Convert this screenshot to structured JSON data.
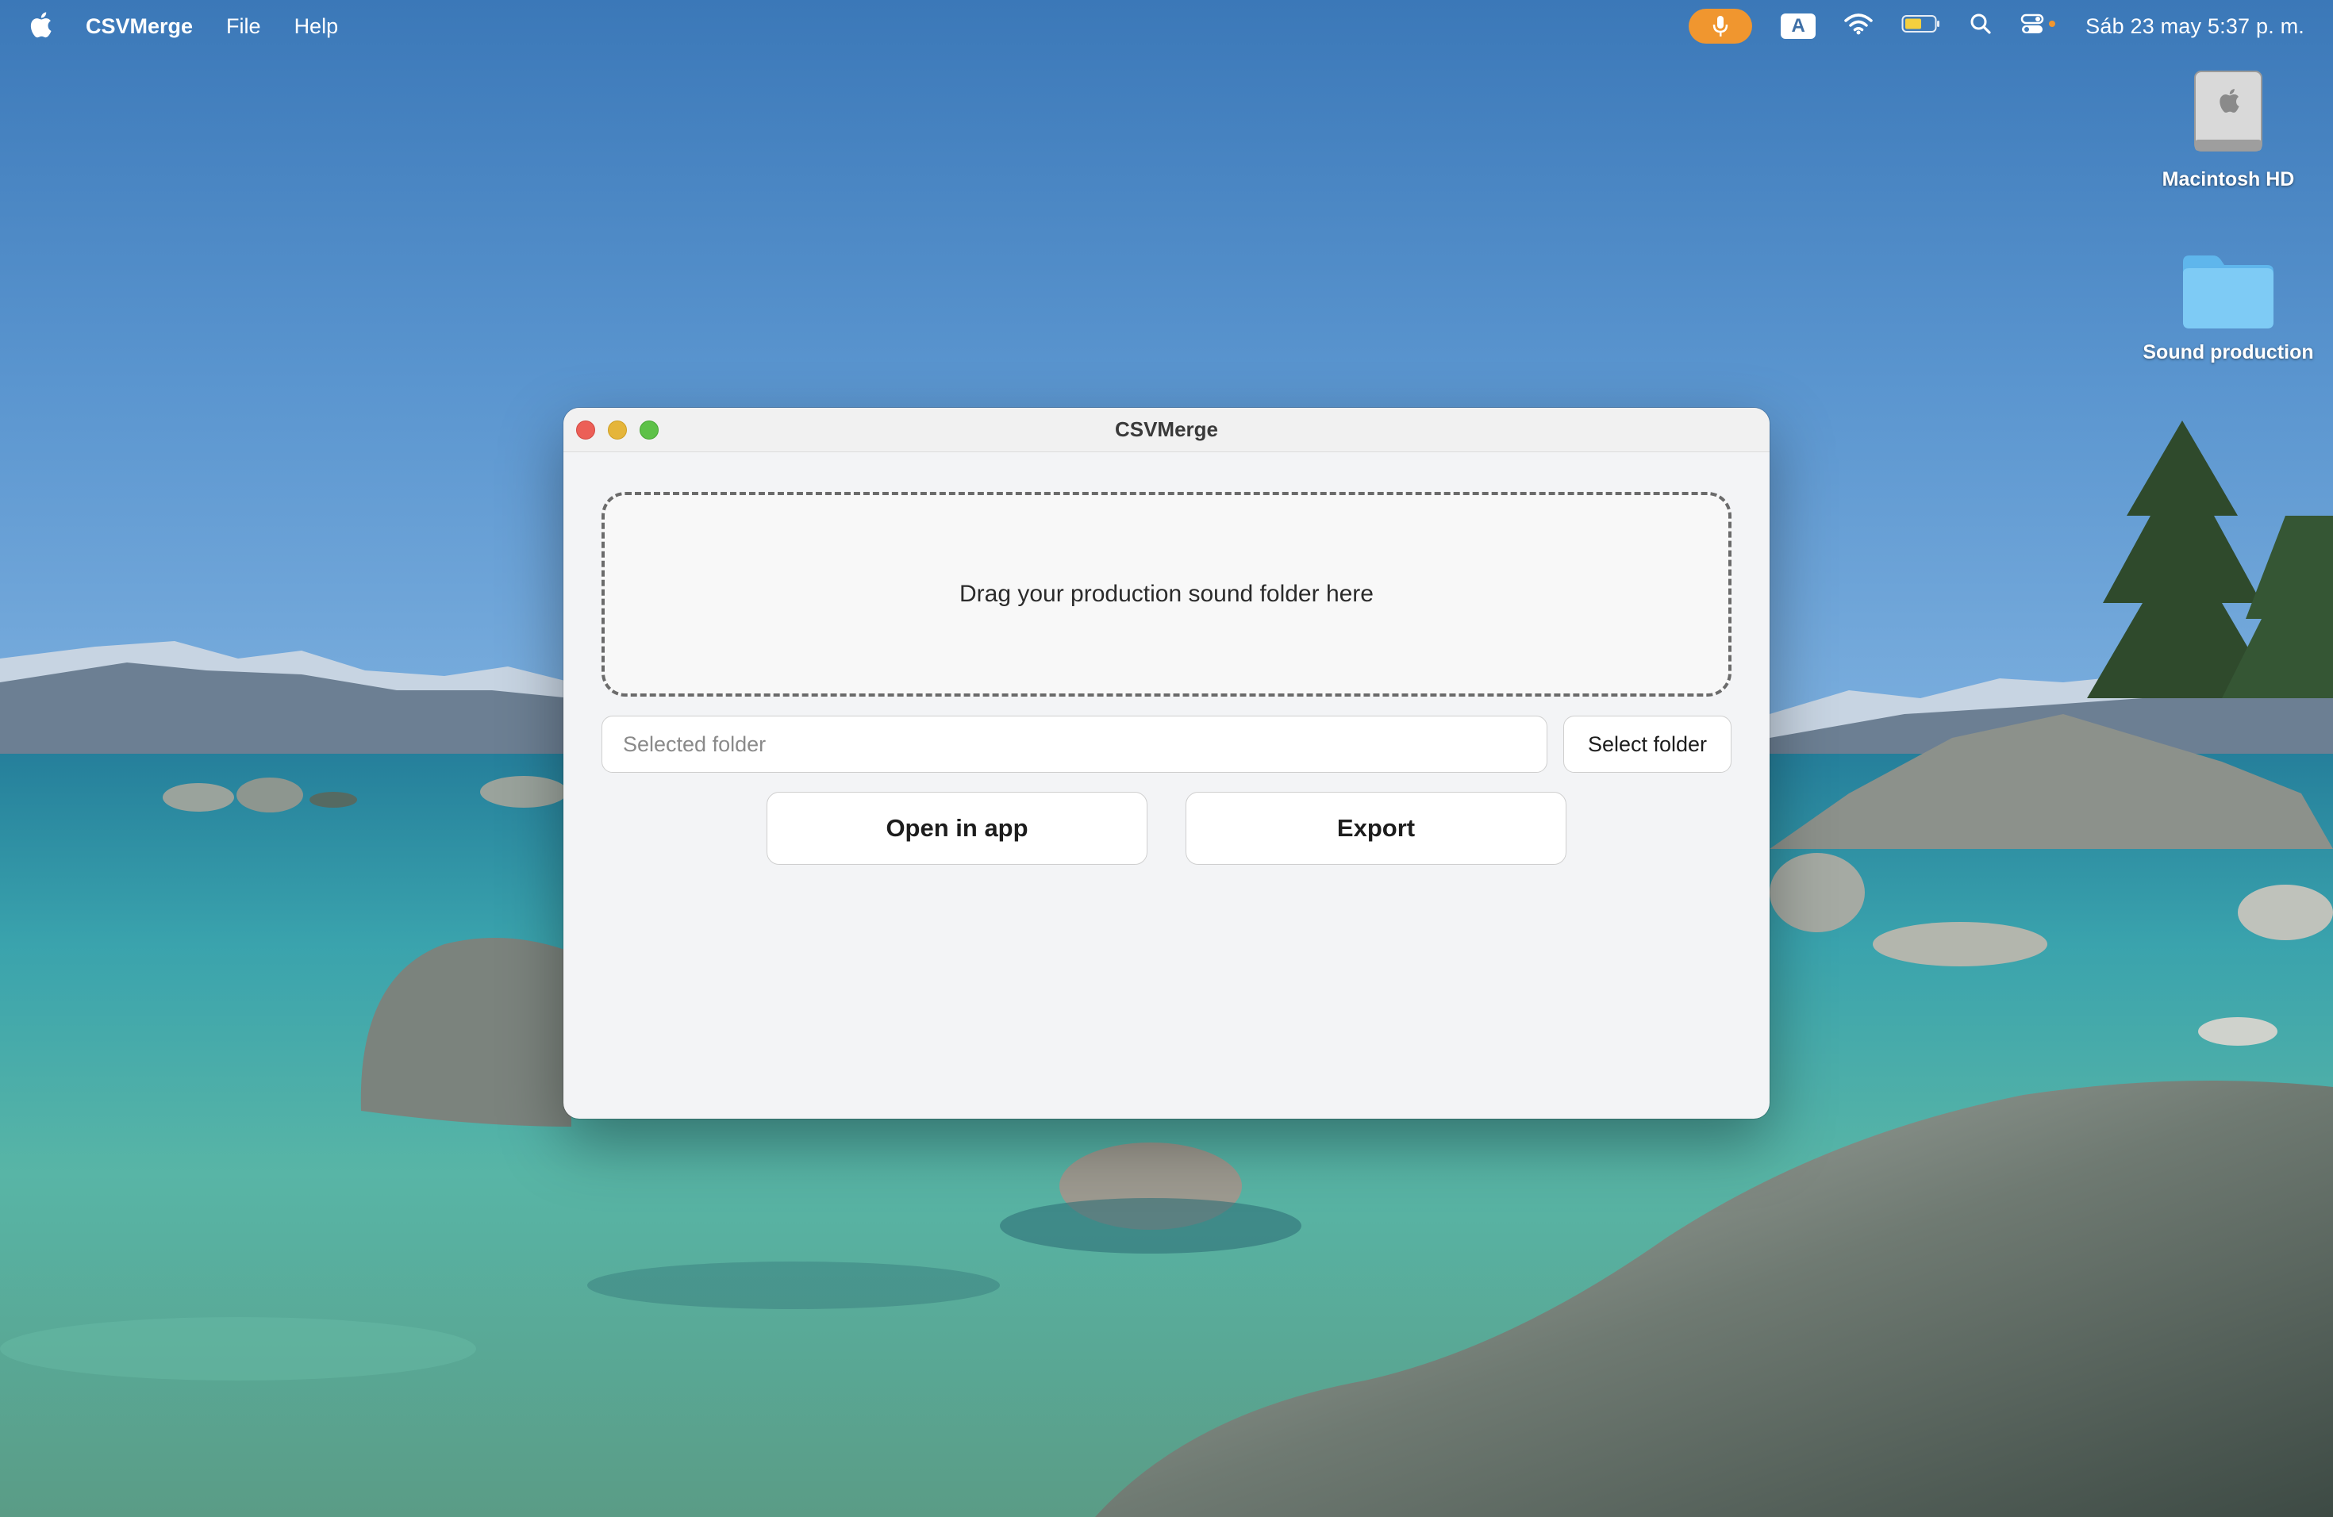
{
  "menubar": {
    "apple_icon": "apple-logo-icon",
    "app_name": "CSVMerge",
    "menus": [
      "File",
      "Help"
    ],
    "status_icons": [
      "microphone-icon",
      "input-source-icon",
      "wifi-icon",
      "battery-icon",
      "spotlight-search-icon",
      "control-center-icon"
    ],
    "input_source_label": "A",
    "clock": "Sáb 23 may  5:37 p. m.",
    "colors": {
      "mic_pill": "#f0962f"
    }
  },
  "desktop": {
    "icons": [
      {
        "label": "Macintosh HD",
        "icon": "hard-drive-icon"
      },
      {
        "label": "Sound production",
        "icon": "folder-icon"
      }
    ]
  },
  "window": {
    "title": "CSVMerge",
    "dropzone_text": "Drag your production sound folder here",
    "folder_input": {
      "value": "",
      "placeholder": "Selected folder"
    },
    "select_folder_label": "Select folder",
    "open_in_app_label": "Open in app",
    "export_label": "Export",
    "colors": {
      "close": "#ec5f57",
      "minimize": "#e5b53a",
      "maximize": "#5dc148"
    }
  }
}
